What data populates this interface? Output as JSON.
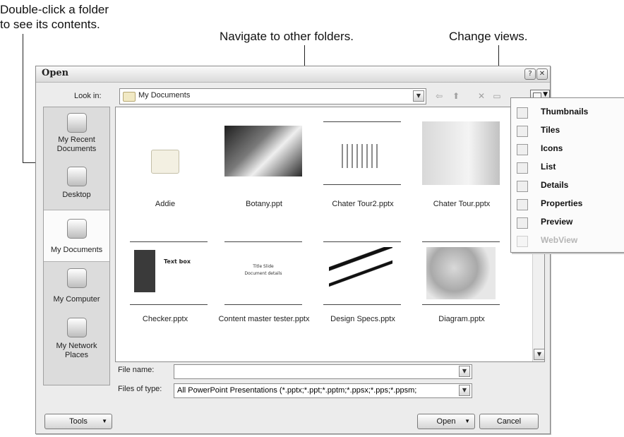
{
  "callouts": {
    "c1_line1": "Double-click a folder",
    "c1_line2": "to see its contents.",
    "c2": "Navigate to other folders.",
    "c3": "Change views."
  },
  "dialog": {
    "title": "Open",
    "help_label": "?",
    "close_label": "✕",
    "look_in_label": "Look in:",
    "look_in_value": "My Documents",
    "places": [
      {
        "label": "My Recent Documents",
        "icon": "recent-documents-icon"
      },
      {
        "label": "Desktop",
        "icon": "desktop-icon"
      },
      {
        "label": "My Documents",
        "icon": "my-documents-icon"
      },
      {
        "label": "My Computer",
        "icon": "my-computer-icon"
      },
      {
        "label": "My Network Places",
        "icon": "network-places-icon"
      }
    ],
    "files": [
      {
        "name": "Addie"
      },
      {
        "name": "Botany.ppt"
      },
      {
        "name": "Chater Tour2.pptx"
      },
      {
        "name": "Chater Tour.pptx"
      },
      {
        "name": "Checker.pptx"
      },
      {
        "name": "Content master tester.pptx"
      },
      {
        "name": "Design Specs.pptx"
      },
      {
        "name": "Diagram.pptx"
      }
    ],
    "thumb_text": {
      "checker_box": "Text box",
      "content_line1": "Title Slide",
      "content_line2": "Document details"
    },
    "file_name_label": "File name:",
    "file_name_value": "",
    "files_of_type_label": "Files of type:",
    "files_of_type_value": "All PowerPoint Presentations (*.pptx;*.ppt;*.pptm;*.ppsx;*.pps;*.ppsm;",
    "tools_label": "Tools",
    "open_label": "Open",
    "cancel_label": "Cancel"
  },
  "views_menu": {
    "items": [
      {
        "label": "Thumbnails",
        "enabled": true,
        "icon": "thumbnails-icon"
      },
      {
        "label": "Tiles",
        "enabled": true,
        "icon": "tiles-icon"
      },
      {
        "label": "Icons",
        "enabled": true,
        "icon": "icons-icon"
      },
      {
        "label": "List",
        "enabled": true,
        "icon": "list-icon"
      },
      {
        "label": "Details",
        "enabled": true,
        "icon": "details-icon"
      },
      {
        "label": "Properties",
        "enabled": true,
        "icon": "properties-icon"
      },
      {
        "label": "Preview",
        "enabled": true,
        "icon": "preview-icon"
      },
      {
        "label": "WebView",
        "enabled": false,
        "icon": "webview-icon"
      }
    ]
  }
}
